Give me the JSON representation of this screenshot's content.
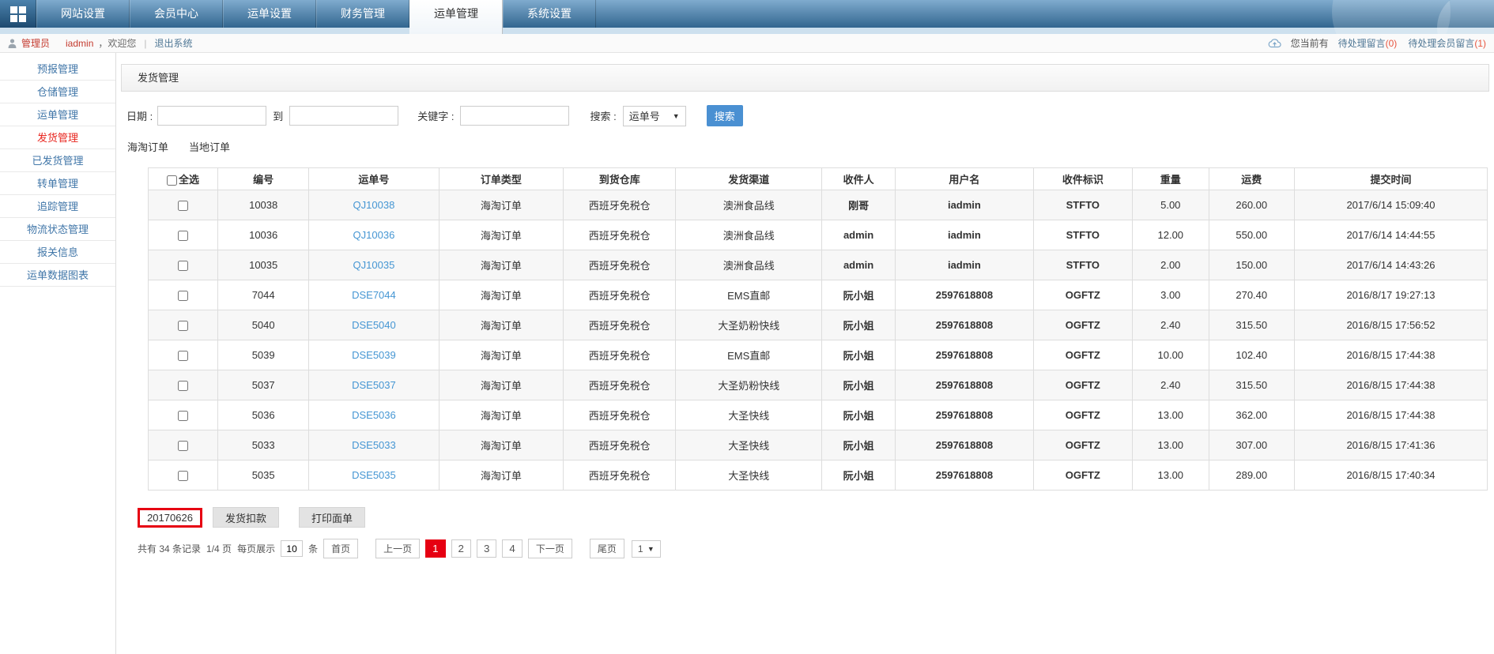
{
  "colors": {
    "accent_blue": "#4a90d2",
    "accent_red": "#e60012",
    "link_blue": "#4596d3",
    "sidebar_blue": "#4076a8"
  },
  "nav": {
    "tabs": [
      "网站设置",
      "会员中心",
      "运单设置",
      "财务管理",
      "运单管理",
      "系统设置"
    ],
    "active_tab": "运单管理"
  },
  "userbar": {
    "role_label": "管理员",
    "username": "iadmin",
    "welcome_text": "，欢迎您",
    "separator": "|",
    "logout_label": "退出系统",
    "notice_prefix": "您当前有",
    "notices": [
      {
        "label": "待处理留言",
        "count": "(0)"
      },
      {
        "label": "待处理会员留言",
        "count": "(1)"
      }
    ]
  },
  "sidebar": {
    "items": [
      "预报管理",
      "仓储管理",
      "运单管理",
      "发货管理",
      "已发货管理",
      "转单管理",
      "追踪管理",
      "物流状态管理",
      "报关信息",
      "运单数据图表"
    ],
    "active_item": "发货管理"
  },
  "panel": {
    "title": "发货管理"
  },
  "filters": {
    "date_label": "日期 :",
    "date_from_value": "",
    "to_label": "到",
    "date_to_value": "",
    "keyword_label": "关键字 :",
    "keyword_value": "",
    "search_label": "搜索 :",
    "search_type_value": "运单号",
    "search_button_label": "搜索"
  },
  "order_tabs": [
    "海淘订单",
    "当地订单"
  ],
  "table": {
    "headers": [
      "全选",
      "编号",
      "运单号",
      "订单类型",
      "到货仓库",
      "发货渠道",
      "收件人",
      "用户名",
      "收件标识",
      "重量",
      "运费",
      "提交时间"
    ],
    "rows": [
      {
        "id": "10038",
        "waybill": "QJ10038",
        "type": "海淘订单",
        "warehouse": "西班牙免税仓",
        "channel": "澳洲食品线",
        "recipient": "刚哥",
        "user": "iadmin",
        "mark": "STFTO",
        "weight": "5.00",
        "fee": "260.00",
        "time": "2017/6/14 15:09:40"
      },
      {
        "id": "10036",
        "waybill": "QJ10036",
        "type": "海淘订单",
        "warehouse": "西班牙免税仓",
        "channel": "澳洲食品线",
        "recipient": "admin",
        "user": "iadmin",
        "mark": "STFTO",
        "weight": "12.00",
        "fee": "550.00",
        "time": "2017/6/14 14:44:55"
      },
      {
        "id": "10035",
        "waybill": "QJ10035",
        "type": "海淘订单",
        "warehouse": "西班牙免税仓",
        "channel": "澳洲食品线",
        "recipient": "admin",
        "user": "iadmin",
        "mark": "STFTO",
        "weight": "2.00",
        "fee": "150.00",
        "time": "2017/6/14 14:43:26"
      },
      {
        "id": "7044",
        "waybill": "DSE7044",
        "type": "海淘订单",
        "warehouse": "西班牙免税仓",
        "channel": "EMS直邮",
        "recipient": "阮小姐",
        "user": "2597618808",
        "mark": "OGFTZ",
        "weight": "3.00",
        "fee": "270.40",
        "time": "2016/8/17 19:27:13"
      },
      {
        "id": "5040",
        "waybill": "DSE5040",
        "type": "海淘订单",
        "warehouse": "西班牙免税仓",
        "channel": "大圣奶粉快线",
        "recipient": "阮小姐",
        "user": "2597618808",
        "mark": "OGFTZ",
        "weight": "2.40",
        "fee": "315.50",
        "time": "2016/8/15 17:56:52"
      },
      {
        "id": "5039",
        "waybill": "DSE5039",
        "type": "海淘订单",
        "warehouse": "西班牙免税仓",
        "channel": "EMS直邮",
        "recipient": "阮小姐",
        "user": "2597618808",
        "mark": "OGFTZ",
        "weight": "10.00",
        "fee": "102.40",
        "time": "2016/8/15 17:44:38"
      },
      {
        "id": "5037",
        "waybill": "DSE5037",
        "type": "海淘订单",
        "warehouse": "西班牙免税仓",
        "channel": "大圣奶粉快线",
        "recipient": "阮小姐",
        "user": "2597618808",
        "mark": "OGFTZ",
        "weight": "2.40",
        "fee": "315.50",
        "time": "2016/8/15 17:44:38"
      },
      {
        "id": "5036",
        "waybill": "DSE5036",
        "type": "海淘订单",
        "warehouse": "西班牙免税仓",
        "channel": "大圣快线",
        "recipient": "阮小姐",
        "user": "2597618808",
        "mark": "OGFTZ",
        "weight": "13.00",
        "fee": "362.00",
        "time": "2016/8/15 17:44:38"
      },
      {
        "id": "5033",
        "waybill": "DSE5033",
        "type": "海淘订单",
        "warehouse": "西班牙免税仓",
        "channel": "大圣快线",
        "recipient": "阮小姐",
        "user": "2597618808",
        "mark": "OGFTZ",
        "weight": "13.00",
        "fee": "307.00",
        "time": "2016/8/15 17:41:36"
      },
      {
        "id": "5035",
        "waybill": "DSE5035",
        "type": "海淘订单",
        "warehouse": "西班牙免税仓",
        "channel": "大圣快线",
        "recipient": "阮小姐",
        "user": "2597618808",
        "mark": "OGFTZ",
        "weight": "13.00",
        "fee": "289.00",
        "time": "2016/8/15 17:40:34"
      }
    ]
  },
  "actions": {
    "batch_input_value": "20170626",
    "deduct_button_label": "发货扣款",
    "print_button_label": "打印面单"
  },
  "pagination": {
    "total_text": "共有 34 条记录",
    "page_text": "1/4 页",
    "per_page_label": "每页展示",
    "per_page_value": "10",
    "per_page_unit": "条",
    "first_label": "首页",
    "prev_label": "上一页",
    "pages": [
      "1",
      "2",
      "3",
      "4"
    ],
    "current_page": "1",
    "next_label": "下一页",
    "last_label": "尾页",
    "page_select_value": "1"
  }
}
